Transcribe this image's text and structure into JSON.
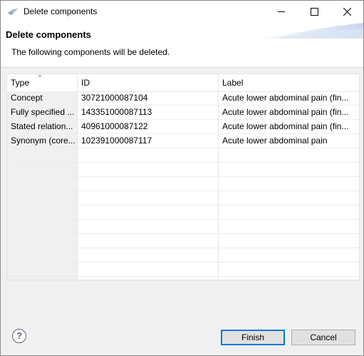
{
  "window": {
    "title": "Delete components"
  },
  "banner": {
    "title": "Delete components",
    "message": "The following components will be deleted."
  },
  "table": {
    "columns": [
      "Type",
      "ID",
      "Label"
    ],
    "sort_column": "Type",
    "rows": [
      {
        "type": "Concept",
        "id": "30721000087104",
        "label": "Acute lower abdominal pain (fin..."
      },
      {
        "type": "Fully specified ...",
        "id": "143351000087113",
        "label": "Acute lower abdominal pain (fin..."
      },
      {
        "type": "Stated relation...",
        "id": "40961000087122",
        "label": "Acute lower abdominal pain (fin..."
      },
      {
        "type": "Synonym (core...",
        "id": "102391000087117",
        "label": "Acute lower abdominal pain"
      }
    ]
  },
  "buttons": {
    "help": "?",
    "finish": "Finish",
    "cancel": "Cancel"
  },
  "colors": {
    "accent": "#0078d7",
    "button_bg": "#e1e1e1",
    "dialog_bg": "#f0f0f0"
  },
  "icons": {
    "app": "eclipse-app-icon",
    "minimize": "minimize-icon",
    "maximize": "maximize-icon",
    "close": "close-icon",
    "help": "help-icon",
    "sort": "sort-ascending-icon"
  }
}
